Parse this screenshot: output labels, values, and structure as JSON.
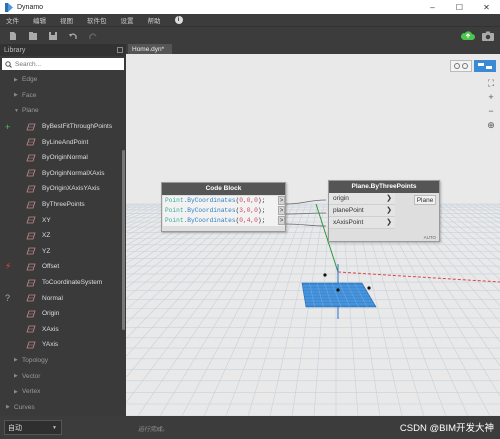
{
  "window": {
    "title": "Dynamo",
    "controls": [
      "–",
      "☐",
      "✕"
    ]
  },
  "menu": {
    "items": [
      "文件",
      "编辑",
      "视图",
      "软件包",
      "设置",
      "帮助"
    ],
    "info_glyph": "i"
  },
  "toolbar": {
    "icons": [
      "new-file-icon",
      "open-file-icon",
      "save-icon",
      "undo-icon",
      "redo-icon",
      "cloud-icon",
      "camera-icon"
    ],
    "cloud_color": "#4cc54c"
  },
  "library": {
    "header": "Library",
    "search_placeholder": "Search...",
    "categories_top": [
      "Edge",
      "Face",
      "Plane"
    ],
    "plane_nodes": [
      {
        "label": "ByBestFitThroughPoints",
        "marker": "+"
      },
      {
        "label": "ByLineAndPoint",
        "marker": ""
      },
      {
        "label": "ByOriginNormal",
        "marker": ""
      },
      {
        "label": "ByOriginNormalXAxis",
        "marker": ""
      },
      {
        "label": "ByOriginXAxisYAxis",
        "marker": ""
      },
      {
        "label": "ByThreePoints",
        "marker": ""
      },
      {
        "label": "XY",
        "marker": ""
      },
      {
        "label": "XZ",
        "marker": ""
      },
      {
        "label": "YZ",
        "marker": ""
      },
      {
        "label": "Offset",
        "marker": "⚡"
      },
      {
        "label": "ToCoordinateSystem",
        "marker": ""
      },
      {
        "label": "Normal",
        "marker": "?"
      },
      {
        "label": "Origin",
        "marker": ""
      },
      {
        "label": "XAxis",
        "marker": ""
      },
      {
        "label": "YAxis",
        "marker": ""
      }
    ],
    "categories_bottom": [
      "Topology",
      "Vector",
      "Vertex",
      "Curves"
    ]
  },
  "tabs": [
    {
      "label": "Home.dyn*"
    }
  ],
  "code_block": {
    "title": "Code Block",
    "lines": [
      {
        "cls": "Point",
        "mth": ".ByCoordinates",
        "open": "(",
        "args": "0,0,0",
        "close": ");",
        "port": ">"
      },
      {
        "cls": "Point",
        "mth": ".ByCoordinates",
        "open": "(",
        "args": "3,0,0",
        "close": ");",
        "port": ">"
      },
      {
        "cls": "Point",
        "mth": ".ByCoordinates",
        "open": "(",
        "args": "0,4,0",
        "close": ");",
        "port": ">"
      }
    ]
  },
  "plane_node": {
    "title": "Plane.ByThreePoints",
    "inputs": [
      "origin",
      "planePoint",
      "xAxisPoint"
    ],
    "input_chev": "❯",
    "output": "Plane",
    "lacing": "AUTO"
  },
  "canvas": {
    "background": "#e9e9e9",
    "grid_color": "#c9d4df",
    "plane_color": "#3a8ad6",
    "zoom_controls": [
      "⛶",
      "+",
      "−",
      "⊕"
    ]
  },
  "status": {
    "run_mode": "自动",
    "run_status": "运行完成。",
    "watermark": "CSDN @BIM开发大神"
  }
}
